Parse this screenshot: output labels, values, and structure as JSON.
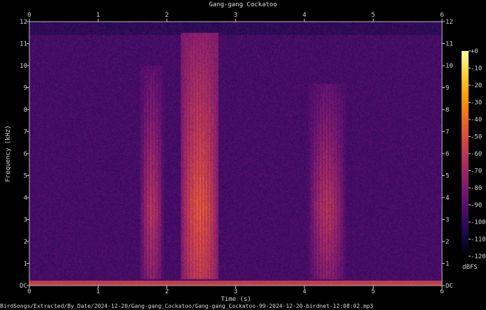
{
  "chart_data": {
    "type": "heatmap",
    "title": "Gang-gang Cockatoo",
    "xlabel": "Time (s)",
    "ylabel": "Frequency (kHz)",
    "xlim": [
      0,
      6
    ],
    "ylim": [
      0,
      12
    ],
    "x_ticks": [
      "0",
      "1",
      "2",
      "3",
      "4",
      "5",
      "6"
    ],
    "y_ticks": [
      "DC",
      "1",
      "2",
      "3",
      "4",
      "5",
      "6",
      "7",
      "8",
      "9",
      "10",
      "11",
      "12"
    ],
    "colorbar": {
      "label": "dBFS",
      "range": [
        -120,
        0
      ],
      "ticks": [
        "+0",
        "-10",
        "-20",
        "-30",
        "-40",
        "-50",
        "-60",
        "-70",
        "-80",
        "-90",
        "-100",
        "-110",
        "-120"
      ],
      "colors": [
        "#000000",
        "#1a0a4a",
        "#4b0c6b",
        "#7a1a6e",
        "#a52c60",
        "#cf4446",
        "#ed6925",
        "#fb9b06",
        "#f7d13d",
        "#fcffa4"
      ]
    },
    "background_db": -95,
    "calls": [
      {
        "t_start": 1.6,
        "t_end": 1.95,
        "f_low": 0.3,
        "f_high": 10.0,
        "peak_db": -55
      },
      {
        "t_start": 2.2,
        "t_end": 2.75,
        "f_low": 0.3,
        "f_high": 11.5,
        "peak_db": -40
      },
      {
        "t_start": 4.05,
        "t_end": 4.6,
        "f_low": 0.3,
        "f_high": 9.2,
        "peak_db": -55
      }
    ],
    "filename": "BirdSongs/Extracted/By_Date/2024-12-20/Gang-gang_Cockatoo/Gang-gang_Cockatoo-99-2024-12-20-birdnet-12:08:02.mp3"
  }
}
